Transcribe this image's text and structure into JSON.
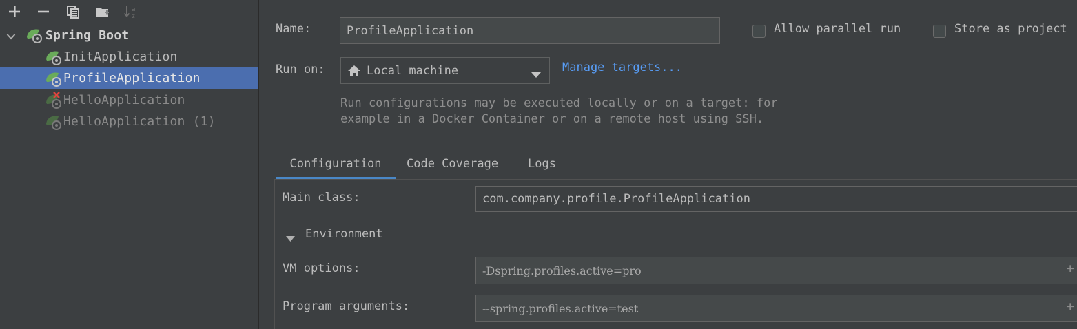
{
  "toolbar": {
    "icons": [
      "add-icon",
      "remove-icon",
      "copy-icon",
      "folder-add-icon",
      "sort-az-icon"
    ]
  },
  "tree": {
    "group": "Spring Boot",
    "items": [
      {
        "label": "InitApplication",
        "state": "normal"
      },
      {
        "label": "ProfileApplication",
        "state": "selected"
      },
      {
        "label": "HelloApplication",
        "state": "error"
      },
      {
        "label": "HelloApplication (1)",
        "state": "disabled"
      }
    ]
  },
  "form": {
    "name_label": "Name:",
    "name_value": "ProfileApplication",
    "allow_parallel_label": "Allow parallel run",
    "store_as_project_label": "Store as project",
    "run_on_label": "Run on:",
    "run_on_value": "Local machine",
    "manage_targets": "Manage targets...",
    "hint_line1": "Run configurations may be executed locally or on a target: for",
    "hint_line2": "example in a Docker Container or on a remote host using SSH."
  },
  "tabs": [
    {
      "label": "Configuration",
      "active": true
    },
    {
      "label": "Code Coverage",
      "active": false
    },
    {
      "label": "Logs",
      "active": false
    }
  ],
  "config": {
    "main_class_label": "Main class:",
    "main_class_value": "com.company.profile.ProfileApplication",
    "environment_label": "Environment",
    "vm_options_label": "VM options:",
    "vm_options_value": "-Dspring.profiles.active=pro",
    "program_args_label": "Program arguments:",
    "program_args_value": "--spring.profiles.active=test"
  },
  "colors": {
    "background": "#3c3f41",
    "selection": "#4b6eaf",
    "link": "#589df6",
    "spring_green": "#6aab5a",
    "error_red": "#e0443e",
    "tab_underline": "#4a88c7"
  }
}
